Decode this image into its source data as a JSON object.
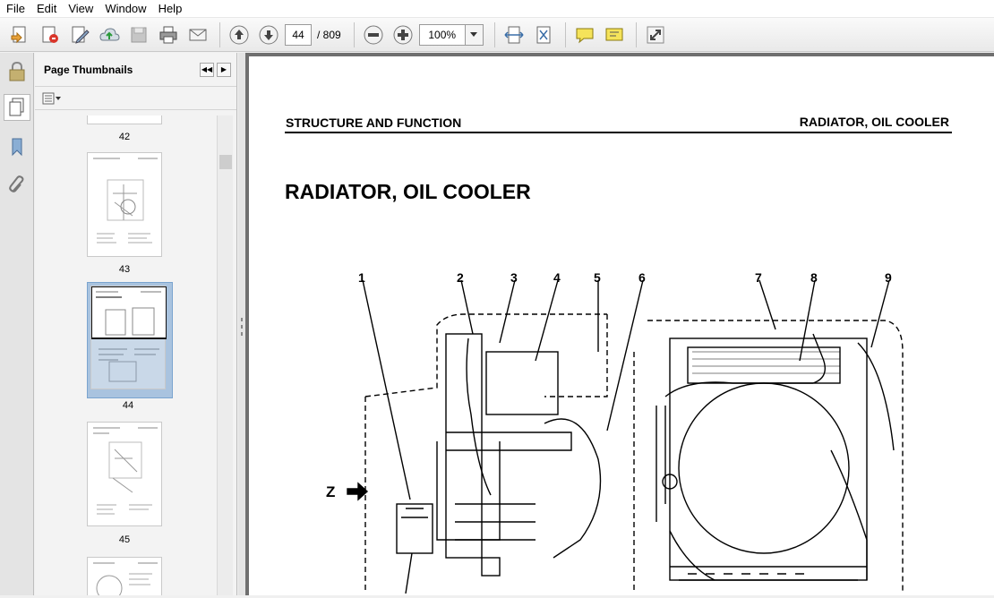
{
  "menu": {
    "items": [
      "File",
      "Edit",
      "View",
      "Window",
      "Help"
    ]
  },
  "toolbar": {
    "page_current": "44",
    "page_total": "/ 809",
    "zoom": "100%",
    "icons": [
      "create-icon",
      "export-icon",
      "edit-icon",
      "upload-icon",
      "save-icon",
      "print-icon",
      "email-icon",
      "previous-page-icon",
      "next-page-icon",
      "zoom-out-icon",
      "zoom-in-icon",
      "fit-width-icon",
      "fit-page-icon",
      "comment-icon",
      "highlight-icon",
      "fullscreen-icon"
    ]
  },
  "sidebar": {
    "title": "Page Thumbnails",
    "thumbnails": [
      {
        "label": "42"
      },
      {
        "label": "43"
      },
      {
        "label": "44",
        "selected": true
      },
      {
        "label": "45"
      }
    ]
  },
  "document": {
    "header_left": "STRUCTURE AND FUNCTION",
    "header_right": "RADIATOR, OIL COOLER",
    "title": "RADIATOR, OIL COOLER",
    "callouts": [
      "1",
      "2",
      "3",
      "4",
      "5",
      "6",
      "7",
      "8",
      "9"
    ],
    "view_label": "Z"
  },
  "colors": {
    "selection": "#a9c3df",
    "doc_background": "#6f6f6f"
  }
}
